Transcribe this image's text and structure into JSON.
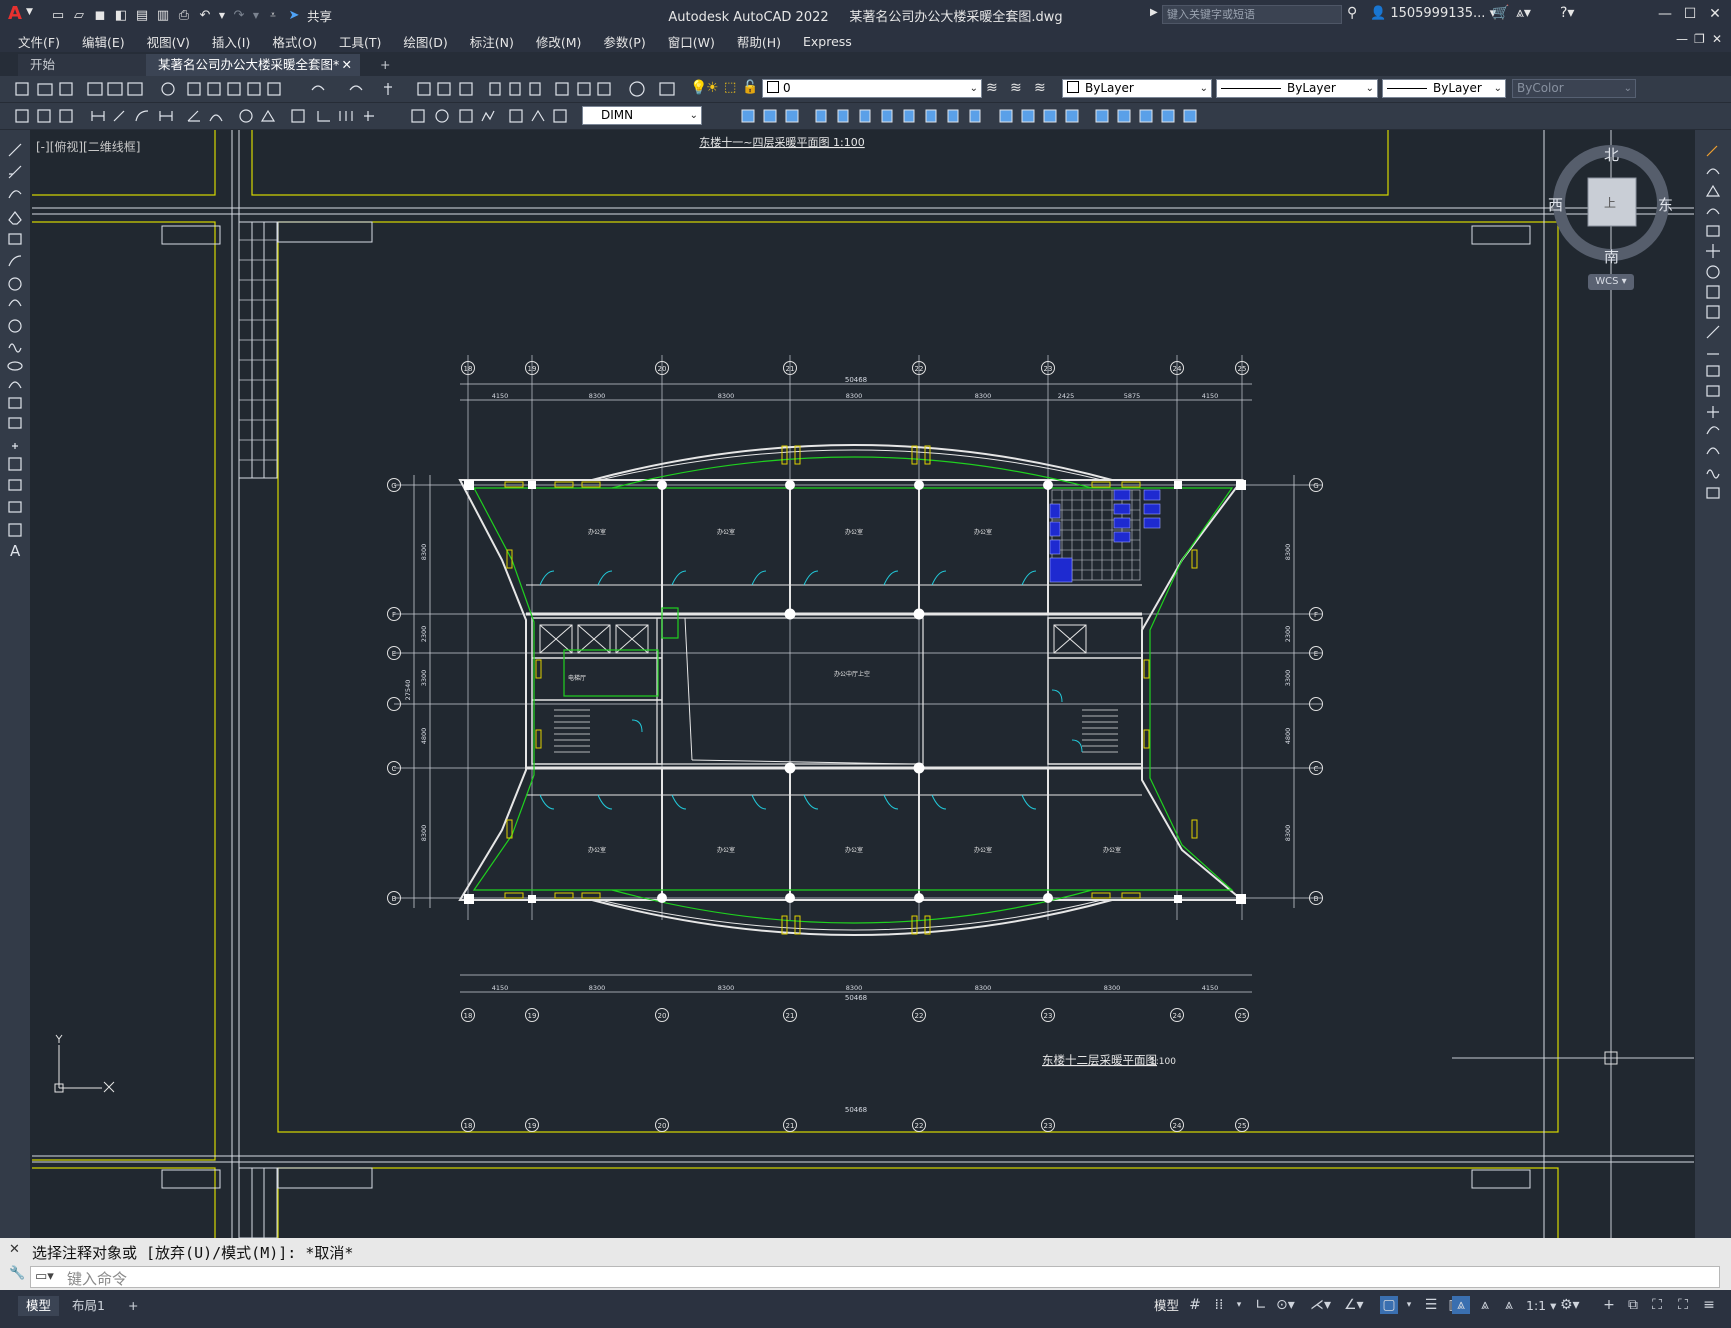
{
  "titlebar": {
    "app_name": "Autodesk AutoCAD 2022",
    "file_name": "某著名公司办公大楼采暖全套图.dwg",
    "share_label": "共享",
    "search_placeholder": "键入关键字或短语",
    "user_name": "1505999135..."
  },
  "menus": [
    "文件(F)",
    "编辑(E)",
    "视图(V)",
    "插入(I)",
    "格式(O)",
    "工具(T)",
    "绘图(D)",
    "标注(N)",
    "修改(M)",
    "参数(P)",
    "窗口(W)",
    "帮助(H)",
    "Express"
  ],
  "tabs": [
    {
      "label": "开始",
      "active": false
    },
    {
      "label": "某著名公司办公大楼采暖全套图*",
      "active": true
    }
  ],
  "toolbar1": {
    "layer_value": "0",
    "color_value": "ByLayer",
    "linetype_value": "ByLayer",
    "lineweight_value": "ByLayer",
    "plotstyle_value": "ByColor"
  },
  "toolbar2": {
    "dimstyle_value": "DIMN"
  },
  "viewport": {
    "label": "[-][俯视][二维线框]",
    "top_drawing_title": "东楼十一~四层采暖平面图 1:100",
    "main_drawing_title": "东楼十二层采暖平面图",
    "main_drawing_scale": "1:100",
    "dim_total_top": "50468",
    "dim_total_bottom": "50468",
    "dim_total_lower": "50468",
    "dims_top": [
      "4150",
      "8300",
      "8300",
      "8300",
      "8300",
      "2425",
      "5875",
      "4150"
    ],
    "dims_bottom": [
      "4150",
      "8300",
      "8300",
      "8300",
      "8300",
      "8300",
      "4150"
    ],
    "dims_left": [
      "8300",
      "2300",
      "3300",
      "4800",
      "8300"
    ],
    "dims_right": [
      "8300",
      "2300",
      "3300",
      "4800",
      "8300"
    ],
    "left_total_dim": "27540",
    "axis_top": [
      "18",
      "19",
      "20",
      "21",
      "22",
      "23",
      "24",
      "25"
    ],
    "axis_left": [
      "G",
      "F",
      "E",
      "D",
      "C",
      "B"
    ],
    "room_office": "办公室",
    "room_atrium": "办公中厅上空",
    "room_elevator": "电梯厅",
    "compass": {
      "north": "北",
      "south": "南",
      "east": "东",
      "west": "西",
      "top": "上",
      "wcs": "WCS"
    }
  },
  "commandline": {
    "history": "选择注释对象或 [放弃(U)/模式(M)]: *取消*",
    "placeholder": "键入命令"
  },
  "statusbar": {
    "tabs": [
      "模型",
      "布局1"
    ],
    "model_label": "模型",
    "scale_label": "1:1"
  }
}
